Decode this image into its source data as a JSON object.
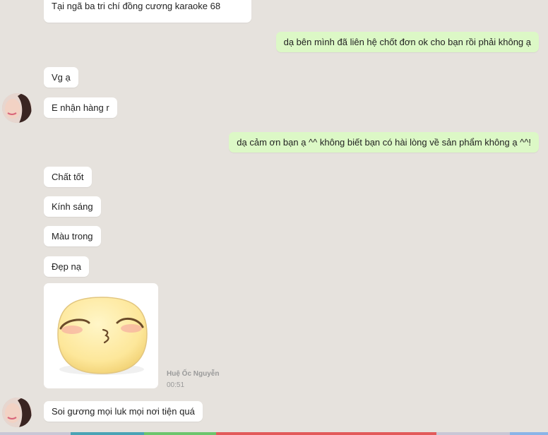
{
  "messages": {
    "top_partial_line": "Tại ngã ba tri chí đồng cương karaoke 68",
    "m1": "dạ bên mình đã liên hệ chốt đơn ok cho bạn rồi phải không ạ",
    "m2": "Vg ạ",
    "m3": "E nhận hàng r",
    "m4": "dạ cảm ơn bạn ạ ^^ không biết bạn có hài lòng về sản phẩm không ạ ^^!",
    "m5": "Chất tốt",
    "m6": "Kính sáng",
    "m7": "Màu trong",
    "m8": "Đẹp nạ",
    "m9": "Soi gương mọi luk mọi nơi tiện quá"
  },
  "sender": {
    "name": "Huệ Ốc Nguyễn",
    "time": "00:51"
  },
  "sticker": {
    "icon": "kissing-face-sticker"
  },
  "colors": {
    "background": "#e6e2dd",
    "incoming_bubble": "#ffffff",
    "outgoing_bubble": "#dcf8c6",
    "bar_gray": "#c9c7d6",
    "bar_teal": "#4aa3b5",
    "bar_green": "#6cc56c",
    "bar_red": "#e25a5a",
    "bar_blue": "#8ab4e8"
  }
}
